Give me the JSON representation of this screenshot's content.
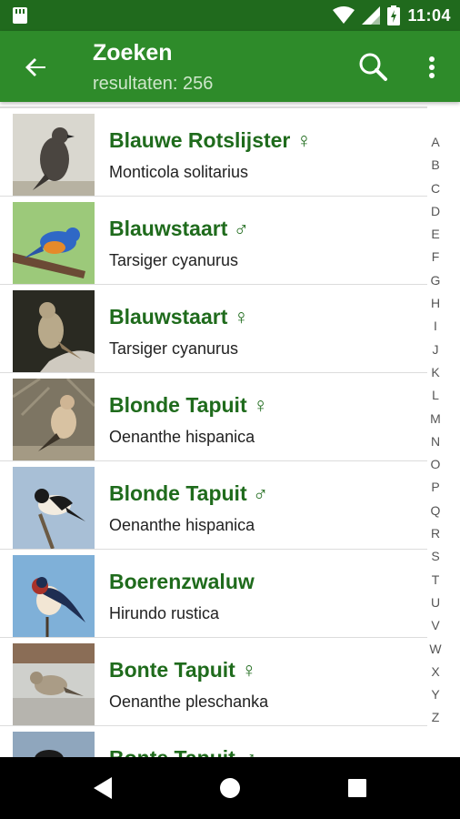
{
  "status_bar": {
    "time": "11:04"
  },
  "toolbar": {
    "title": "Zoeken",
    "subtitle": "resultaten: 256"
  },
  "results": [
    {
      "name": "Blauwe Rotslijster ♀",
      "scientific": "Monticola solitarius"
    },
    {
      "name": "Blauwstaart ♂",
      "scientific": "Tarsiger cyanurus"
    },
    {
      "name": "Blauwstaart ♀",
      "scientific": "Tarsiger cyanurus"
    },
    {
      "name": "Blonde Tapuit ♀",
      "scientific": "Oenanthe hispanica"
    },
    {
      "name": "Blonde Tapuit ♂",
      "scientific": "Oenanthe hispanica"
    },
    {
      "name": "Boerenzwaluw",
      "scientific": "Hirundo rustica"
    },
    {
      "name": "Bonte Tapuit ♀",
      "scientific": "Oenanthe pleschanka"
    },
    {
      "name": "Bonte Tapuit ♂",
      "scientific": ""
    }
  ],
  "alphabet_index": [
    "A",
    "B",
    "C",
    "D",
    "E",
    "F",
    "G",
    "H",
    "I",
    "J",
    "K",
    "L",
    "M",
    "N",
    "O",
    "P",
    "Q",
    "R",
    "S",
    "T",
    "U",
    "V",
    "W",
    "X",
    "Y",
    "Z"
  ],
  "colors": {
    "status_bar": "#206a1d",
    "toolbar": "#2e8b2a",
    "title_green": "#1f6b1c"
  },
  "icons": {
    "back": "arrow-back-icon",
    "search": "search-icon",
    "more": "more-vert-icon",
    "nav_back": "nav-back-icon",
    "nav_home": "nav-home-icon",
    "nav_recents": "nav-recents-icon"
  }
}
